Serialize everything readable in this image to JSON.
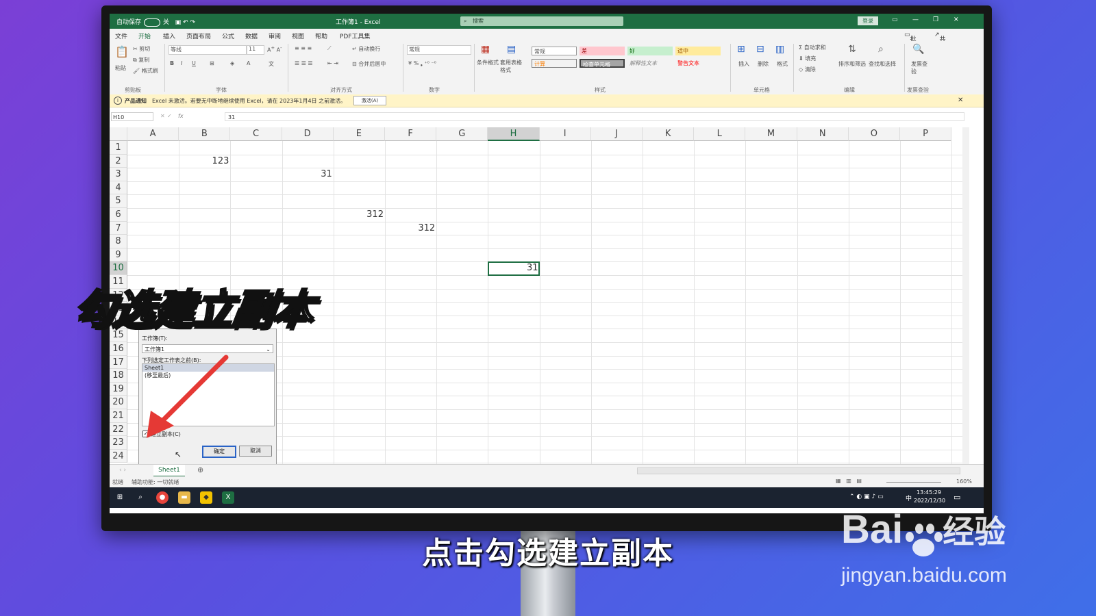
{
  "titlebar": {
    "autosave": "自动保存",
    "autosave_state": "关",
    "title": "工作簿1 - Excel",
    "search_placeholder": "搜索",
    "login": "登录"
  },
  "menu": [
    "文件",
    "开始",
    "插入",
    "页面布局",
    "公式",
    "数据",
    "审阅",
    "视图",
    "帮助",
    "PDF工具集"
  ],
  "menu_right": {
    "comment": "批注",
    "share": "共享"
  },
  "ribbon": {
    "clipboard": {
      "paste": "粘贴",
      "cut": "剪切",
      "copy": "复制",
      "format_painter": "格式刷",
      "group": "剪贴板"
    },
    "font": {
      "name": "等线",
      "size": "11",
      "group": "字体"
    },
    "align": {
      "wrap": "自动换行",
      "merge": "合并后居中",
      "group": "对齐方式"
    },
    "number": {
      "format": "常规",
      "group": "数字"
    },
    "styles": {
      "cond": "条件格式",
      "table": "套用表格格式",
      "normal": "常规",
      "bad": "差",
      "good": "好",
      "neutral": "适中",
      "calc": "计算",
      "check": "检查单元格",
      "explain": "解释性文本",
      "warn": "警告文本",
      "group": "样式"
    },
    "cells": {
      "insert": "插入",
      "delete": "删除",
      "format": "格式",
      "group": "单元格"
    },
    "edit": {
      "autosum": "自动求和",
      "fill": "填充",
      "clear": "清除",
      "sort": "排序和筛选",
      "find": "查找和选择",
      "group": "编辑"
    },
    "invoice": {
      "label": "发票查验",
      "group": "发票查验"
    }
  },
  "notification": {
    "tag": "产品通知",
    "text": "Excel 未激活。若要无中断地继续使用 Excel，请在 2023年1月4日 之前激活。",
    "button": "激活(A)"
  },
  "formula_bar": {
    "name_box": "H10",
    "fx": "fx",
    "value": "31"
  },
  "columns": [
    "A",
    "B",
    "C",
    "D",
    "E",
    "F",
    "G",
    "H",
    "I",
    "J",
    "K",
    "L",
    "M",
    "N",
    "O",
    "P"
  ],
  "rows": [
    "1",
    "2",
    "3",
    "4",
    "5",
    "6",
    "7",
    "8",
    "9",
    "10",
    "11",
    "12",
    "13",
    "14",
    "15",
    "16",
    "17",
    "18",
    "19",
    "20",
    "21",
    "22",
    "23",
    "24"
  ],
  "cells": [
    {
      "ref": "B2",
      "value": "123"
    },
    {
      "ref": "D3",
      "value": "31"
    },
    {
      "ref": "E6",
      "value": "312"
    },
    {
      "ref": "F7",
      "value": "312"
    },
    {
      "ref": "H10",
      "value": "31"
    }
  ],
  "dialog": {
    "workbook_label": "工作簿(T):",
    "workbook_value": "工作簿1",
    "before_label": "下列选定工作表之前(B):",
    "sheets": [
      "Sheet1",
      "(移至最后)"
    ],
    "copy_label": "建立副本(C)",
    "ok": "确定",
    "cancel": "取消"
  },
  "sheet_tab": "Sheet1",
  "status": {
    "ready": "就绪",
    "accessibility": "辅助功能: 一切就绪",
    "zoom": "160%"
  },
  "taskbar": {
    "time": "13:45:29",
    "date": "2022/12/30",
    "ime": "中"
  },
  "overlay_title": "勾选建立副本",
  "subtitle": "点击勾选建立副本",
  "watermark": {
    "brand": "Bai",
    "brand_cn": "经验",
    "url": "jingyan.baidu.com"
  },
  "colors": {
    "excel_green": "#1e6e42",
    "notification": "#fff4c7",
    "arrow": "#e53935"
  }
}
